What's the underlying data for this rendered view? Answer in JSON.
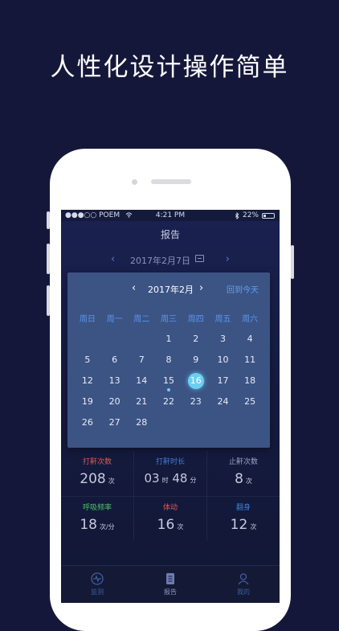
{
  "headline": "人性化设计操作简单",
  "status_bar": {
    "carrier": "●●●○○ POEM",
    "time": "4:21 PM",
    "battery": "22%"
  },
  "nav_title": "报告",
  "date_bar": {
    "date": "2017年2月7日",
    "prev_icon": "chevron-left-icon",
    "next_icon": "chevron-right-icon"
  },
  "calendar": {
    "title": "2017年2月",
    "today_label": "回到今天",
    "weekdays": [
      "周日",
      "周一",
      "周二",
      "周三",
      "周四",
      "周五",
      "周六"
    ],
    "rows": [
      [
        "",
        "",
        "",
        "1",
        "2",
        "3",
        "4"
      ],
      [
        "5",
        "6",
        "7",
        "8",
        "9",
        "10",
        "11"
      ],
      [
        "12",
        "13",
        "14",
        "15",
        "16",
        "17",
        "18"
      ],
      [
        "19",
        "20",
        "21",
        "22",
        "23",
        "24",
        "25"
      ],
      [
        "26",
        "27",
        "28",
        "",
        "",
        "",
        ""
      ]
    ],
    "selected_day": "16",
    "marked_day": "15",
    "accent": "#6ccff1"
  },
  "stats": [
    {
      "label": "打鼾次数",
      "value": "208",
      "unit": "次",
      "color": "#e0584f"
    },
    {
      "label": "打鼾时长",
      "value": "03",
      "unit": "时",
      "value2": "48",
      "unit2": "分",
      "color": "#3d7fd6"
    },
    {
      "label": "止鼾次数",
      "value": "8",
      "unit": "次",
      "color": "#9aa3c6"
    },
    {
      "label": "呼吸频率",
      "value": "18",
      "unit": "次/分",
      "color": "#4cc06a"
    },
    {
      "label": "体动",
      "value": "16",
      "unit": "次",
      "color": "#e0584f"
    },
    {
      "label": "翻身",
      "value": "12",
      "unit": "次",
      "color": "#3d7fd6"
    }
  ],
  "tabs": [
    {
      "label": "监测",
      "icon": "monitor-icon"
    },
    {
      "label": "报告",
      "icon": "report-icon"
    },
    {
      "label": "我的",
      "icon": "profile-icon"
    }
  ]
}
